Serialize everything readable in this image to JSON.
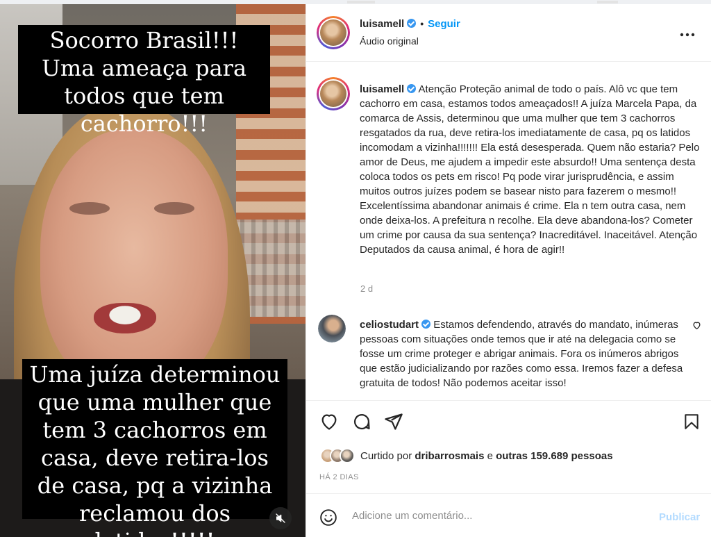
{
  "media": {
    "caption_top": "Socorro Brasil!!! Uma ameaça para todos que tem cachorro!!!",
    "caption_bottom": "Uma juíza determinou que uma mulher que tem 3 cachorros em casa, deve retira-los de casa, pq a vizinha reclamou dos latidos!!!!!",
    "mute_icon": "speaker-muted-icon"
  },
  "header": {
    "username": "luisamell",
    "separator": "•",
    "follow_label": "Seguir",
    "audio": "Áudio original",
    "more_icon": "more-options-icon"
  },
  "post": {
    "username": "luisamell",
    "caption": "Atenção Proteção animal de todo o país. Alô vc que tem cachorro em casa, estamos todos ameaçados!! A juíza Marcela Papa, da comarca de Assis, determinou que uma mulher que tem 3 cachorros resgatados da rua, deve retira-los imediatamente de casa, pq os latidos incomodam a vizinha!!!!!!! Ela está desesperada. Quem não estaria? Pelo amor de Deus, me ajudem a impedir este absurdo!! Uma sentença desta coloca todos os pets em risco! Pq pode virar jurisprudência, e assim muitos outros juízes podem se basear nisto para fazerem o mesmo!! Excelentíssima abandonar animais é crime. Ela n tem outra casa, nem onde deixa-los. A prefeitura n recolhe. Ela deve abandona-los? Cometer um crime por causa da sua sentença? Inacreditável. Inaceitável. Atenção Deputados da causa animal, é hora de agir!!",
    "time": "2 d"
  },
  "comment": {
    "username": "celiostudart",
    "text": "Estamos defendendo, através do mandato, inúmeras pessoas com situações onde temos que ir até na delegacia como se fosse um crime proteger e abrigar animais. Fora os inúmeros abrigos que estão judicializando por razões como essa. Iremos fazer a defesa gratuita de todos! Não podemos aceitar isso!"
  },
  "actions": {
    "like_icon": "heart-icon",
    "comment_icon": "comment-icon",
    "share_icon": "paper-plane-icon",
    "save_icon": "bookmark-icon"
  },
  "likes": {
    "prefix": "Curtido por",
    "user": "dribarrosmais",
    "joiner": "e",
    "others": "outras 159.689 pessoas",
    "avatar_colors": [
      "#c9a27c",
      "#8e7a6b",
      "#5d5a57"
    ]
  },
  "posted_ago": "HÁ 2 DIAS",
  "add_comment": {
    "placeholder": "Adicione um comentário...",
    "publish_label": "Publicar",
    "emoji_icon": "emoji-icon"
  },
  "colors": {
    "link_blue": "#0095f6",
    "publish_disabled": "#b3dbff",
    "muted_text": "#8e8e8e",
    "verified_blue": "#3897f0"
  }
}
